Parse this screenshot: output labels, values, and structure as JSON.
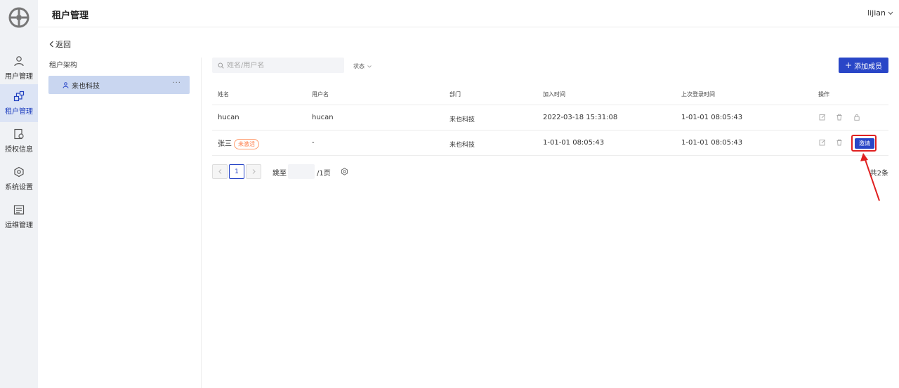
{
  "header": {
    "title": "租户管理",
    "user": "lijian"
  },
  "sidebar": {
    "items": [
      {
        "label": "用户管理",
        "icon": "user-icon",
        "active": false
      },
      {
        "label": "租户管理",
        "icon": "tenant-icon",
        "active": true
      },
      {
        "label": "授权信息",
        "icon": "license-icon",
        "active": false
      },
      {
        "label": "系统设置",
        "icon": "settings-icon",
        "active": false
      },
      {
        "label": "运维管理",
        "icon": "ops-icon",
        "active": false
      }
    ]
  },
  "left_panel": {
    "back_label": "返回",
    "tree_title": "租户架构",
    "tree_node": "来也科技",
    "more": "···"
  },
  "toolbar": {
    "search_placeholder": "姓名/用户名",
    "status_label": "状态",
    "add_label": "添加成员"
  },
  "table": {
    "columns": [
      "姓名",
      "用户名",
      "部门",
      "加入时间",
      "上次登录时间",
      "操作"
    ],
    "rows": [
      {
        "name": "hucan",
        "badge": "",
        "username": "hucan",
        "dept": "来也科技",
        "joined": "2022-03-18 15:31:08",
        "last_login": "1-01-01 08:05:43"
      },
      {
        "name": "张三",
        "badge": "未激活",
        "username": "-",
        "dept": "来也科技",
        "joined": "1-01-01 08:05:43",
        "last_login": "1-01-01 08:05:43",
        "invite": "邀请"
      }
    ]
  },
  "pagination": {
    "current_page": "1",
    "jump_label": "跳至",
    "total_pages": "/1页",
    "total_count": "共2条"
  },
  "colors": {
    "primary": "#2946c7",
    "highlight": "#e02020",
    "badge": "#ff7a45"
  }
}
